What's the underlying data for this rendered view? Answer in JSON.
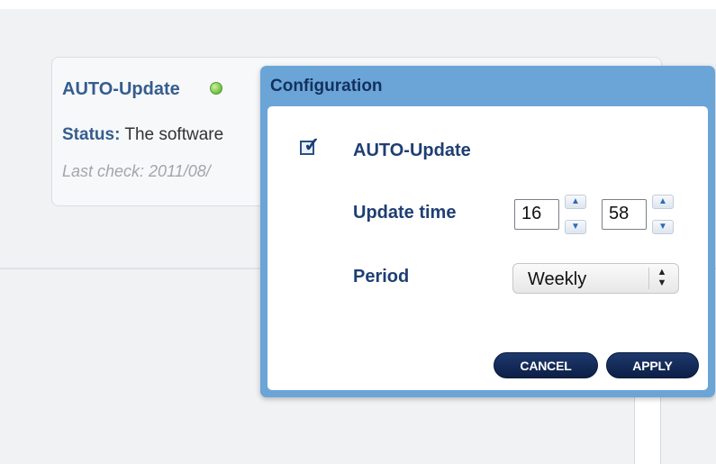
{
  "status_card": {
    "title": "AUTO-Update",
    "status_label": "Status:",
    "status_text": "The software",
    "last_check": "Last check: 2011/08/"
  },
  "dialog": {
    "title": "Configuration",
    "auto_update_label": "AUTO-Update",
    "auto_update_checked": true,
    "update_time_label": "Update time",
    "hour": "16",
    "minute": "58",
    "period_label": "Period",
    "period_value": "Weekly",
    "cancel_label": "CANCEL",
    "apply_label": "APPLY"
  },
  "icons": {
    "status": "status-green-dot-icon",
    "checkbox": "checkbox-checked-icon",
    "up": "arrow-up-icon",
    "down": "arrow-down-icon",
    "select": "select-updown-icon"
  },
  "colors": {
    "dialog_header": "#6ba5d8",
    "label_blue": "#1e3f73",
    "button_navy": "#0c1f45",
    "status_green": "#7fcd4d"
  }
}
